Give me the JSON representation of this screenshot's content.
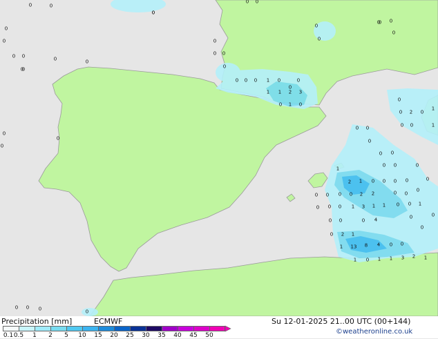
{
  "map": {
    "colors": {
      "sea": "#e6e6e6",
      "land": "#c0f5a0",
      "precip_light": "#b4f0fa",
      "precip_medium": "#78dcf0",
      "precip_heavy": "#3cbef0"
    },
    "labels": [
      {
        "id": "a1",
        "text": "0"
      },
      {
        "id": "a2",
        "text": "0"
      },
      {
        "id": "a3",
        "text": "0"
      },
      {
        "id": "a4",
        "text": "0"
      },
      {
        "id": "a5",
        "text": "0"
      },
      {
        "id": "a6",
        "text": "0"
      },
      {
        "id": "a7",
        "text": "0"
      },
      {
        "id": "a8",
        "text": "0"
      },
      {
        "id": "a9",
        "text": "0"
      },
      {
        "id": "a10",
        "text": "0"
      },
      {
        "id": "a11",
        "text": "0"
      },
      {
        "id": "a12",
        "text": "0"
      },
      {
        "id": "a13",
        "text": "0"
      },
      {
        "id": "a14",
        "text": "0"
      },
      {
        "id": "a15",
        "text": "0"
      },
      {
        "id": "a16",
        "text": "0"
      },
      {
        "id": "a17",
        "text": "0"
      },
      {
        "id": "a18",
        "text": "0"
      },
      {
        "id": "a19",
        "text": "0"
      },
      {
        "id": "a20",
        "text": "0"
      },
      {
        "id": "a21",
        "text": "0"
      },
      {
        "id": "a22",
        "text": "0"
      },
      {
        "id": "a23",
        "text": "0"
      },
      {
        "id": "a24",
        "text": "0"
      },
      {
        "id": "b1",
        "text": "0"
      },
      {
        "id": "b2",
        "text": "0"
      },
      {
        "id": "b3",
        "text": "0"
      },
      {
        "id": "b4",
        "text": "1"
      },
      {
        "id": "b5",
        "text": "0"
      },
      {
        "id": "b6",
        "text": "0"
      },
      {
        "id": "b7",
        "text": "1"
      },
      {
        "id": "b8",
        "text": "1"
      },
      {
        "id": "b9",
        "text": "2"
      },
      {
        "id": "b10",
        "text": "3"
      },
      {
        "id": "b11",
        "text": "0"
      },
      {
        "id": "b12",
        "text": "1"
      },
      {
        "id": "b13",
        "text": "0"
      },
      {
        "id": "b14",
        "text": "0"
      },
      {
        "id": "c1",
        "text": "0"
      },
      {
        "id": "c2",
        "text": "2"
      },
      {
        "id": "c3",
        "text": "1"
      },
      {
        "id": "c4",
        "text": "0"
      },
      {
        "id": "c5",
        "text": "0"
      },
      {
        "id": "c6",
        "text": "0"
      },
      {
        "id": "c7",
        "text": "0"
      },
      {
        "id": "c8",
        "text": "1"
      },
      {
        "id": "c9",
        "text": "0"
      },
      {
        "id": "c10",
        "text": "0"
      },
      {
        "id": "c11",
        "text": "0"
      },
      {
        "id": "c12",
        "text": "0"
      },
      {
        "id": "c13",
        "text": "0"
      },
      {
        "id": "c14",
        "text": "0"
      },
      {
        "id": "c15",
        "text": "0"
      },
      {
        "id": "c16",
        "text": "0"
      },
      {
        "id": "d1",
        "text": "1"
      },
      {
        "id": "d2",
        "text": "2"
      },
      {
        "id": "d3",
        "text": "1"
      },
      {
        "id": "d4",
        "text": "0"
      },
      {
        "id": "d5",
        "text": "0"
      },
      {
        "id": "d6",
        "text": "0"
      },
      {
        "id": "d7",
        "text": "0"
      },
      {
        "id": "d8",
        "text": "2"
      },
      {
        "id": "d9",
        "text": "0"
      },
      {
        "id": "d10",
        "text": "2"
      },
      {
        "id": "d11",
        "text": "0"
      },
      {
        "id": "d12",
        "text": "0"
      },
      {
        "id": "d13",
        "text": "0"
      },
      {
        "id": "d14",
        "text": "0"
      },
      {
        "id": "d15",
        "text": "0"
      },
      {
        "id": "d16",
        "text": "0"
      },
      {
        "id": "d17",
        "text": "0"
      },
      {
        "id": "d18",
        "text": "0"
      },
      {
        "id": "d19",
        "text": "0"
      },
      {
        "id": "d20",
        "text": "3"
      },
      {
        "id": "d21",
        "text": "1"
      },
      {
        "id": "d22",
        "text": "1"
      },
      {
        "id": "d23",
        "text": "0"
      },
      {
        "id": "d24",
        "text": "1"
      },
      {
        "id": "d25",
        "text": "0"
      },
      {
        "id": "d26",
        "text": "0"
      },
      {
        "id": "d27",
        "text": "1"
      },
      {
        "id": "d28",
        "text": "0"
      },
      {
        "id": "d29",
        "text": "0"
      },
      {
        "id": "d30",
        "text": "0"
      },
      {
        "id": "d31",
        "text": "4"
      },
      {
        "id": "d32",
        "text": "0"
      },
      {
        "id": "d33",
        "text": "0"
      },
      {
        "id": "d34",
        "text": "0"
      },
      {
        "id": "e1",
        "text": "2"
      },
      {
        "id": "e2",
        "text": "1"
      },
      {
        "id": "e3",
        "text": "0"
      },
      {
        "id": "e4",
        "text": "1"
      },
      {
        "id": "e5",
        "text": "13"
      },
      {
        "id": "e6",
        "text": "8"
      },
      {
        "id": "e7",
        "text": "4"
      },
      {
        "id": "e8",
        "text": "0"
      },
      {
        "id": "e9",
        "text": "0"
      },
      {
        "id": "e10",
        "text": "1"
      },
      {
        "id": "e11",
        "text": "0"
      },
      {
        "id": "e12",
        "text": "1"
      },
      {
        "id": "e13",
        "text": "1"
      },
      {
        "id": "e14",
        "text": "3"
      },
      {
        "id": "e15",
        "text": "2"
      },
      {
        "id": "e16",
        "text": "1"
      },
      {
        "id": "f1",
        "text": "0"
      },
      {
        "id": "f2",
        "text": "0"
      },
      {
        "id": "f3",
        "text": "0"
      },
      {
        "id": "f4",
        "text": "0"
      },
      {
        "id": "f5",
        "text": "0"
      },
      {
        "id": "f6",
        "text": "0"
      },
      {
        "id": "f7",
        "text": "0"
      }
    ]
  },
  "footer": {
    "title": "Precipitation [mm]",
    "model": "ECMWF",
    "datetime": "Su 12-01-2025 21..00 UTC (00+144)",
    "credit": "©weatheronline.co.uk",
    "legend": {
      "ticks": [
        "0.1",
        "0.5",
        "1",
        "2",
        "5",
        "10",
        "15",
        "20",
        "25",
        "30",
        "35",
        "40",
        "45",
        "50"
      ],
      "colors": [
        "#f5fafa",
        "#c8f5fa",
        "#a0ebfa",
        "#78dcf0",
        "#50c8f0",
        "#3cb4f0",
        "#1e8cdc",
        "#0a64c8",
        "#0a3296",
        "#1e0a64",
        "#a000c8",
        "#c800dc",
        "#dc00c8",
        "#f000b4"
      ]
    }
  }
}
